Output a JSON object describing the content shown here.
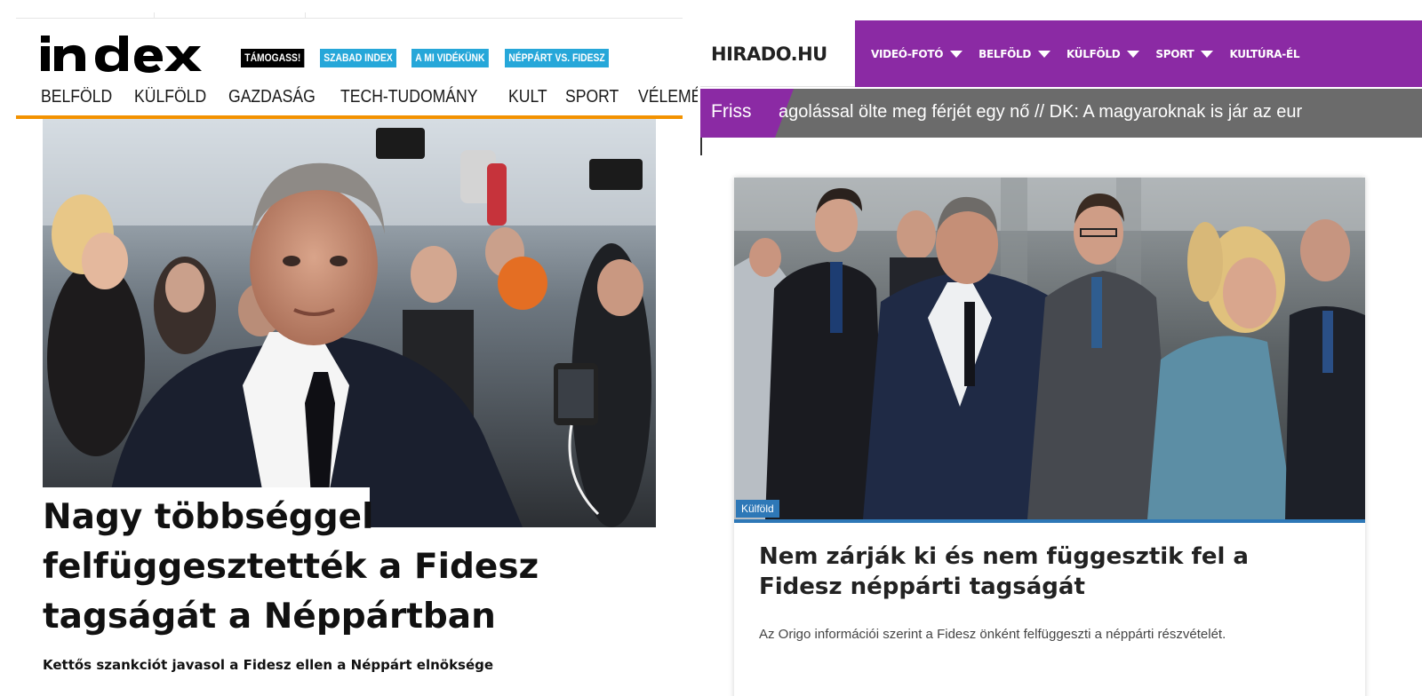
{
  "index": {
    "logo": "index",
    "tags": [
      {
        "label": "TÁMOGASS!",
        "style": "dark"
      },
      {
        "label": "SZABAD INDEX",
        "style": "blue"
      },
      {
        "label": "A MI VIDÉKÜNK",
        "style": "blue"
      },
      {
        "label": "NÉPPÁRT VS. FIDESZ",
        "style": "blue"
      }
    ],
    "nav": [
      "BELFÖLD",
      "KÜLFÖLD",
      "GAZDASÁG",
      "TECH-TUDOMÁNY",
      "KULT",
      "SPORT",
      "VÉLEMÉN"
    ],
    "headline": "Nagy többséggel felfüggesztették a Fidesz tagságát a Néppártban",
    "lead": "Kettős szankciót javasol a Fidesz ellen a Néppárt elnöksége",
    "accent": "#f39200",
    "tag_blue": "#26a7d9"
  },
  "hirado": {
    "logo": "HIRADO.HU",
    "nav": [
      "VIDEÓ-FOTÓ",
      "BELFÖLD",
      "KÜLFÖLD",
      "SPORT",
      "KULTÚRA-ÉL"
    ],
    "friss_label": "Friss",
    "ticker": "agolással ölte meg férjét egy nő // DK: A magyaroknak is jár az eur",
    "category": "Külföld",
    "headline": "Nem zárják ki és nem függesztik fel a Fidesz néppárti tagságát",
    "lead": "Az Origo információi szerint a Fidesz önként felfüggeszti a néppárti részvételét.",
    "brand_color": "#8b2aa4",
    "badge_color": "#2e78b7"
  }
}
